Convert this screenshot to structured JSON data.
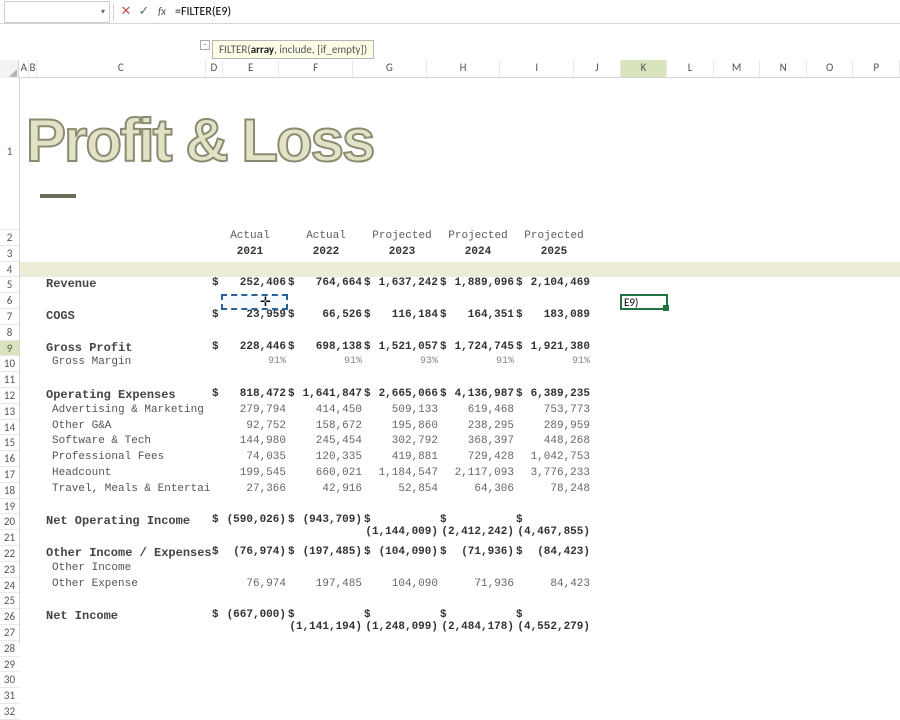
{
  "formula_bar": {
    "name_box": "",
    "formula": "=FILTER(E9)",
    "tooltip_before": "FILTER(",
    "tooltip_bold": "array",
    "tooltip_after": ", include, [if_empty])"
  },
  "columns": [
    "A",
    "B",
    "C",
    "D",
    "E",
    "F",
    "G",
    "H",
    "I",
    "J",
    "K",
    "L",
    "M",
    "N",
    "O",
    "P"
  ],
  "rows": [
    "1",
    "2",
    "3",
    "4",
    "5",
    "6",
    "7",
    "8",
    "9",
    "10",
    "11",
    "12",
    "13",
    "14",
    "15",
    "16",
    "17",
    "18",
    "19",
    "20",
    "21",
    "22",
    "23",
    "24",
    "25",
    "26",
    "27",
    "28",
    "29",
    "30",
    "31",
    "32"
  ],
  "title": "Profit & Loss",
  "headers": {
    "type": [
      "Actual",
      "Actual",
      "Projected",
      "Projected",
      "Projected"
    ],
    "year": [
      "2021",
      "2022",
      "2023",
      "2024",
      "2025"
    ]
  },
  "lines": {
    "revenue": {
      "label": "Revenue",
      "vals": [
        "252,406",
        "764,664",
        "1,637,242",
        "1,889,096",
        "2,104,469"
      ],
      "bold": true,
      "d": true
    },
    "cogs": {
      "label": "COGS",
      "vals": [
        "23,959",
        "66,526",
        "116,184",
        "164,351",
        "183,089"
      ],
      "bold": true,
      "d": true
    },
    "gp": {
      "label": "Gross Profit",
      "vals": [
        "228,446",
        "698,138",
        "1,521,057",
        "1,724,745",
        "1,921,380"
      ],
      "bold": true,
      "d": true
    },
    "gm": {
      "label": "Gross Margin",
      "vals": [
        "91%",
        "91%",
        "93%",
        "91%",
        "91%"
      ],
      "sub": true,
      "gm": true
    },
    "opex": {
      "label": "Operating Expenses",
      "vals": [
        "818,472",
        "1,641,847",
        "2,665,066",
        "4,136,987",
        "6,389,235"
      ],
      "bold": true,
      "d": true
    },
    "adv": {
      "label": "Advertising & Marketing",
      "vals": [
        "279,794",
        "414,450",
        "509,133",
        "619,468",
        "753,773"
      ],
      "sub": true
    },
    "oga": {
      "label": "Other G&A",
      "vals": [
        "92,752",
        "158,672",
        "195,860",
        "238,295",
        "289,959"
      ],
      "sub": true
    },
    "swt": {
      "label": "Software & Tech",
      "vals": [
        "144,980",
        "245,454",
        "302,792",
        "368,397",
        "448,268"
      ],
      "sub": true
    },
    "pf": {
      "label": "Professional Fees",
      "vals": [
        "74,035",
        "120,335",
        "419,881",
        "729,428",
        "1,042,753"
      ],
      "sub": true
    },
    "hc": {
      "label": "Headcount",
      "vals": [
        "199,545",
        "660,021",
        "1,184,547",
        "2,117,093",
        "3,776,233"
      ],
      "sub": true
    },
    "tme": {
      "label": "Travel, Meals & Entertainm",
      "vals": [
        "27,366",
        "42,916",
        "52,854",
        "64,306",
        "78,248"
      ],
      "sub": true
    },
    "noi": {
      "label": "Net Operating Income",
      "vals": [
        "(590,026)",
        "(943,709)",
        "(1,144,009)",
        "(2,412,242)",
        "(4,467,855)"
      ],
      "bold": true,
      "d": true
    },
    "oie": {
      "label": "Other Income / Expenses",
      "vals": [
        "(76,974)",
        "(197,485)",
        "(104,090)",
        "(71,936)",
        "(84,423)"
      ],
      "bold": true,
      "d": true
    },
    "oi": {
      "label": "Other Income",
      "vals": [
        "",
        "",
        "",
        "",
        ""
      ],
      "sub": true
    },
    "oe": {
      "label": "Other Expense",
      "vals": [
        "76,974",
        "197,485",
        "104,090",
        "71,936",
        "84,423"
      ],
      "sub": true
    },
    "ni": {
      "label": "Net Income",
      "vals": [
        "(667,000)",
        "(1,141,194)",
        "(1,248,099)",
        "(2,484,178)",
        "(4,552,279)"
      ],
      "bold": true,
      "d": true
    }
  },
  "active_cell_text": "E9)",
  "selected_range": "E9"
}
